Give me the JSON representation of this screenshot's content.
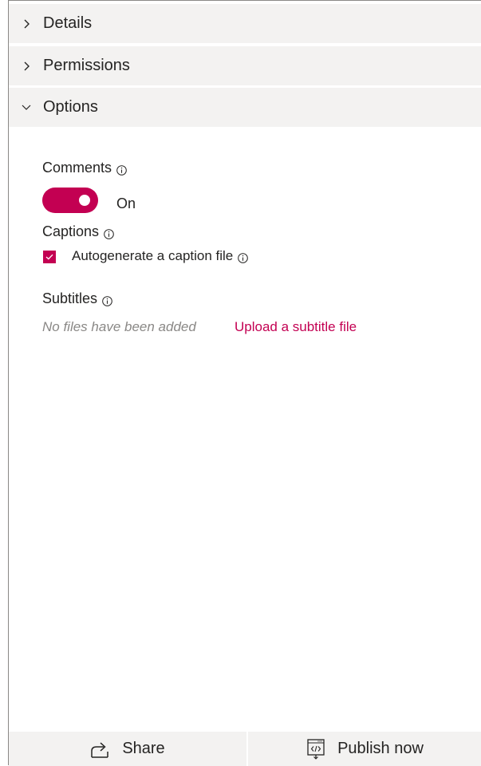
{
  "sections": {
    "details": {
      "label": "Details",
      "expanded": false
    },
    "permissions": {
      "label": "Permissions",
      "expanded": false
    },
    "options": {
      "label": "Options",
      "expanded": true
    }
  },
  "options": {
    "comments": {
      "label": "Comments",
      "toggle_state_text": "On",
      "enabled": true
    },
    "captions": {
      "label": "Captions",
      "autogenerate_label": "Autogenerate a caption file",
      "autogenerate_checked": true
    },
    "subtitles": {
      "label": "Subtitles",
      "empty_text": "No files have been added",
      "upload_link": "Upload a subtitle file"
    }
  },
  "footer": {
    "share_label": "Share",
    "publish_label": "Publish now"
  },
  "colors": {
    "accent": "#c30052",
    "header_bg": "#f3f2f1",
    "muted_text": "#8a8886"
  }
}
